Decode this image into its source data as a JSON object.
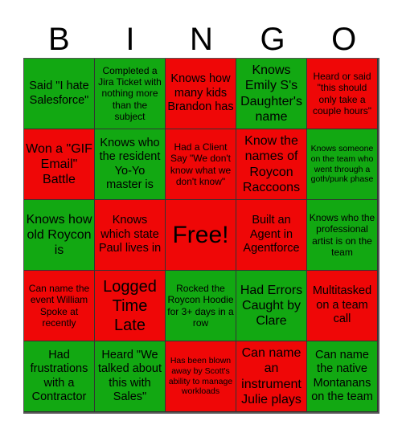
{
  "header": {
    "letters": [
      "B",
      "I",
      "N",
      "G",
      "O"
    ]
  },
  "colors": {
    "green": "#12a812",
    "red": "#ef0707",
    "text": "#000000"
  },
  "cells": [
    {
      "text": "Said \"I hate Salesforce\"",
      "color": "green",
      "size": "s-md"
    },
    {
      "text": "Completed a Jira Ticket with nothing more than the subject",
      "color": "green",
      "size": "s-sm"
    },
    {
      "text": "Knows how many kids Brandon has",
      "color": "red",
      "size": "s-md"
    },
    {
      "text": "Knows Emily S's Daughter's name",
      "color": "green",
      "size": "s-lg"
    },
    {
      "text": "Heard or said \"this should only take a couple hours\"",
      "color": "red",
      "size": "s-sm"
    },
    {
      "text": "Won a \"GIF Email\" Battle",
      "color": "red",
      "size": "s-lg"
    },
    {
      "text": "Knows who the resident Yo-Yo master is",
      "color": "green",
      "size": "s-md"
    },
    {
      "text": "Had a Client Say \"We don't know what we don't know\"",
      "color": "red",
      "size": "s-sm"
    },
    {
      "text": "Know the names of Roycon Raccoons",
      "color": "red",
      "size": "s-lg"
    },
    {
      "text": "Knows someone on the team who went through a goth/punk phase",
      "color": "green",
      "size": "s-xs"
    },
    {
      "text": "Knows how old Roycon is",
      "color": "green",
      "size": "s-lg"
    },
    {
      "text": "Knows which state Paul lives in",
      "color": "red",
      "size": "s-md"
    },
    {
      "text": "Free!",
      "color": "red",
      "size": "s-xxl"
    },
    {
      "text": "Built an Agent in Agentforce",
      "color": "red",
      "size": "s-md"
    },
    {
      "text": "Knows who the professional artist is on the team",
      "color": "green",
      "size": "s-sm"
    },
    {
      "text": "Can name the event William Spoke at recently",
      "color": "red",
      "size": "s-sm"
    },
    {
      "text": "Logged Time Late",
      "color": "red",
      "size": "s-xl"
    },
    {
      "text": "Rocked the Roycon Hoodie for 3+ days in a row",
      "color": "green",
      "size": "s-sm"
    },
    {
      "text": "Had Errors Caught by Clare",
      "color": "green",
      "size": "s-lg"
    },
    {
      "text": "Multitasked on a team call",
      "color": "red",
      "size": "s-md"
    },
    {
      "text": "Had frustrations with a Contractor",
      "color": "green",
      "size": "s-md"
    },
    {
      "text": "Heard \"We talked about this with Sales\"",
      "color": "green",
      "size": "s-md"
    },
    {
      "text": "Has been blown away by Scott's ability to manage workloads",
      "color": "red",
      "size": "s-xs"
    },
    {
      "text": "Can name an instrument Julie plays",
      "color": "red",
      "size": "s-lg"
    },
    {
      "text": "Can name the native Montanans on the team",
      "color": "green",
      "size": "s-md"
    }
  ]
}
